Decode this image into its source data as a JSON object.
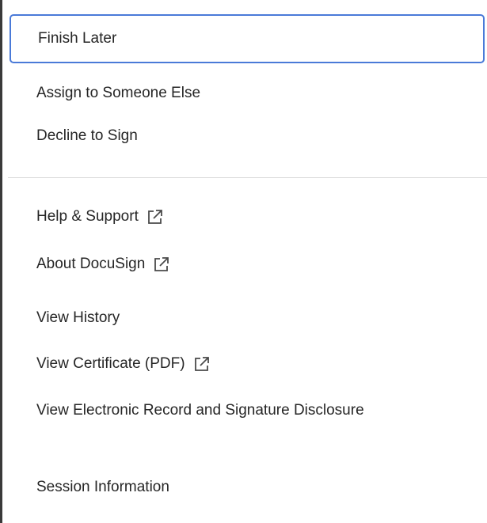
{
  "menu": {
    "primary_items": [
      {
        "label": "Finish Later"
      },
      {
        "label": "Assign to Someone Else"
      },
      {
        "label": "Decline to Sign"
      }
    ],
    "secondary_items": [
      {
        "label": "Help & Support",
        "external": true
      },
      {
        "label": "About DocuSign",
        "external": true
      },
      {
        "label": "View History",
        "external": false
      },
      {
        "label": "View Certificate (PDF)",
        "external": true
      },
      {
        "label": "View Electronic Record and Signature Disclosure",
        "external": false
      },
      {
        "label": "Session Information",
        "external": false
      }
    ]
  },
  "colors": {
    "focus_ring": "#4a7ad8",
    "text": "#262626",
    "divider": "#dcdcdc"
  },
  "icons": {
    "external_link": "external-link-icon"
  }
}
